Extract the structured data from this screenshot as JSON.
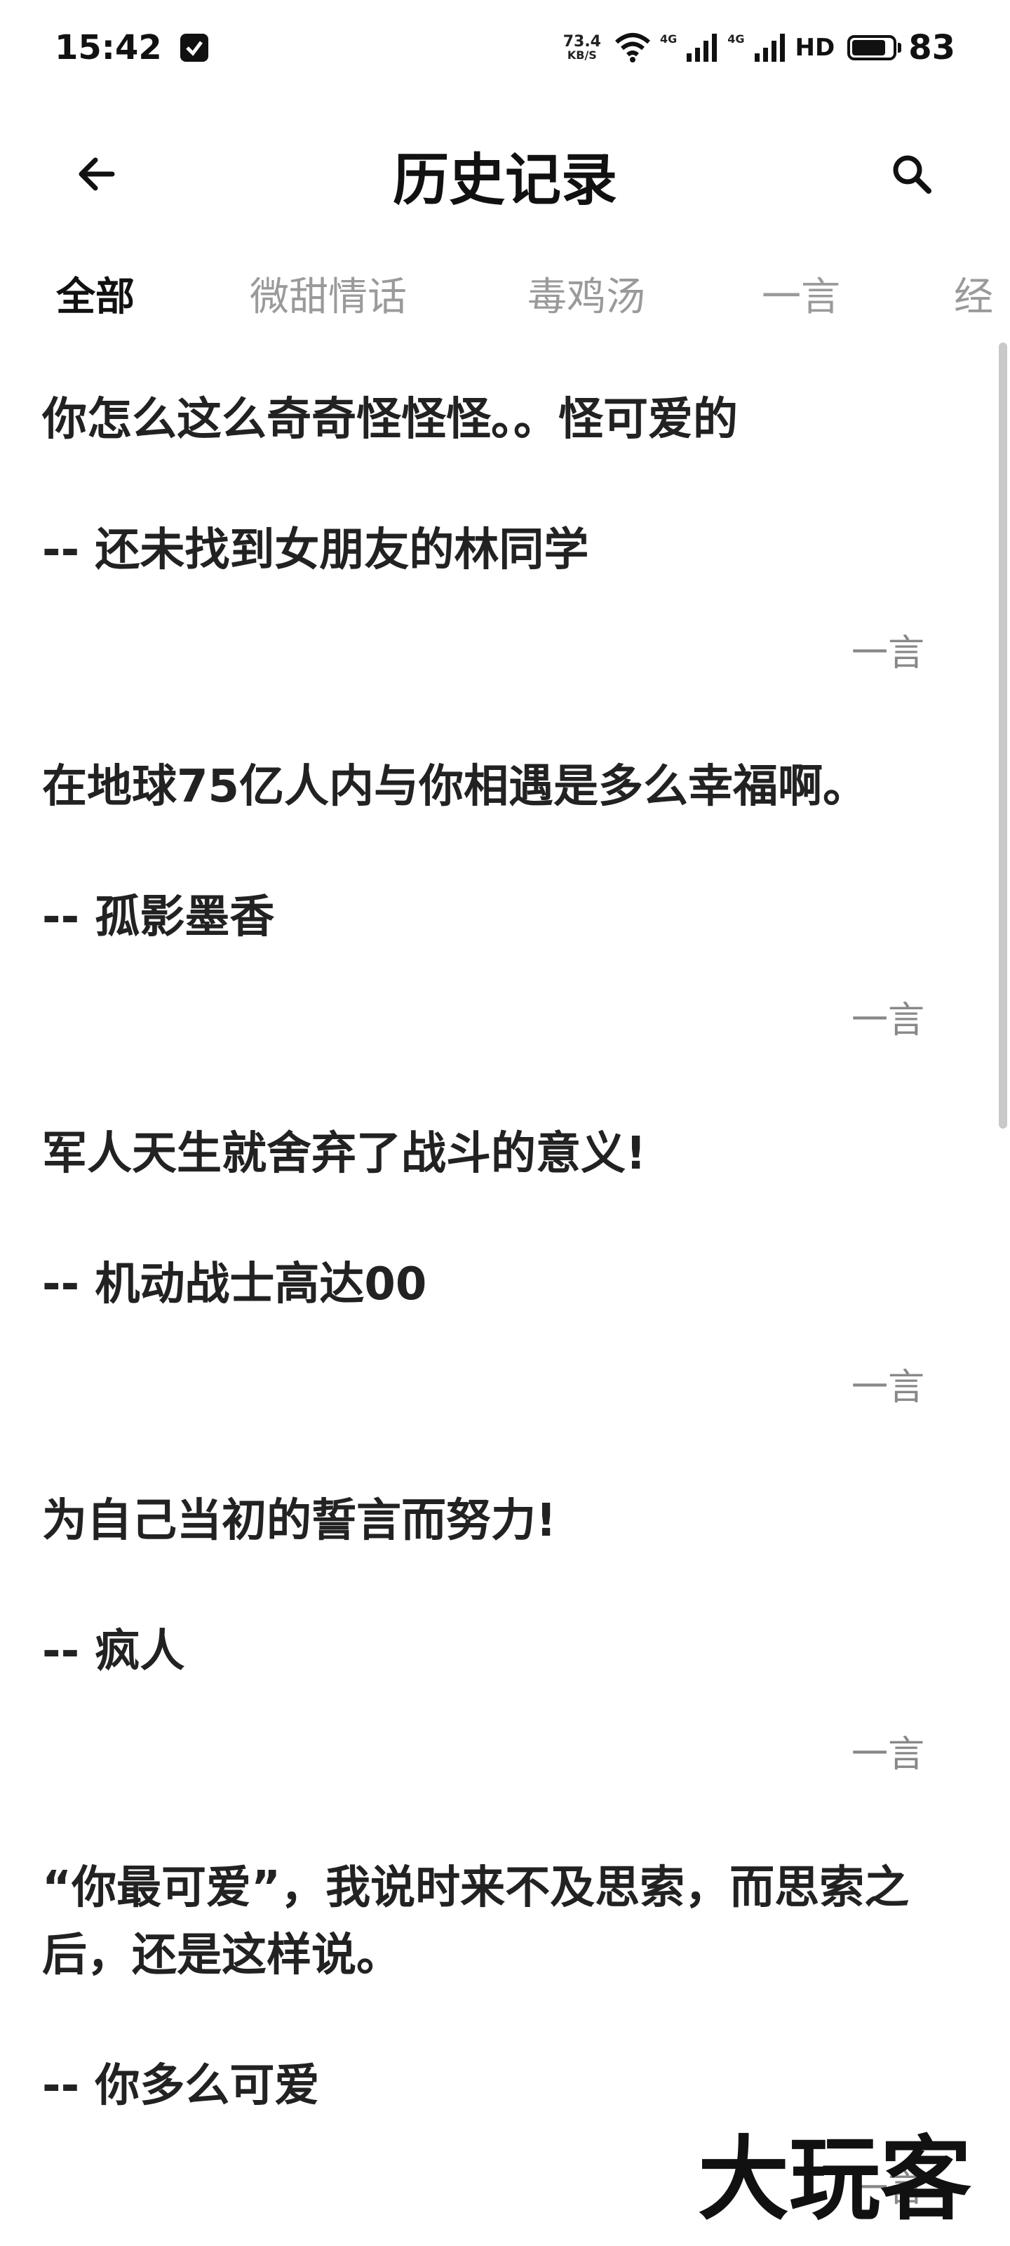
{
  "status_bar": {
    "time": "15:42",
    "net_speed_value": "73.4",
    "net_speed_unit": "KB/S",
    "signal_1_label": "4G",
    "signal_2_label": "4G",
    "hd_label": "HD",
    "battery": "83",
    "battery_level": 0.83
  },
  "header": {
    "title": "历史记录",
    "back_icon": "arrow-left-icon",
    "search_icon": "search-icon"
  },
  "tabs": [
    {
      "label": "全部",
      "active": true
    },
    {
      "label": "微甜情话",
      "active": false
    },
    {
      "label": "毒鸡汤",
      "active": false
    },
    {
      "label": "一言",
      "active": false
    },
    {
      "label": "经",
      "active": false
    }
  ],
  "items": [
    {
      "quote": "你怎么这么奇奇怪怪怪。。怪可爱的",
      "author": "-- 还未找到女朋友的林同学",
      "tag": "一言"
    },
    {
      "quote": "在地球75亿人内与你相遇是多么幸福啊。",
      "author": "-- 孤影墨香",
      "tag": "一言"
    },
    {
      "quote": "军人天生就舍弃了战斗的意义!",
      "author": "-- 机动战士高达00",
      "tag": "一言"
    },
    {
      "quote": "为自己当初的誓言而努力!",
      "author": "-- 疯人",
      "tag": "一言"
    },
    {
      "quote": "“你最可爱”，我说时来不及思索，而思索之后，还是这样说。",
      "author": "-- 你多么可爱",
      "tag": "一言"
    }
  ],
  "watermark": {
    "text": "大玩客"
  },
  "colors": {
    "text": "#222222",
    "tab_inactive": "#9a9a9a",
    "tag": "#888888",
    "background": "#ffffff"
  }
}
